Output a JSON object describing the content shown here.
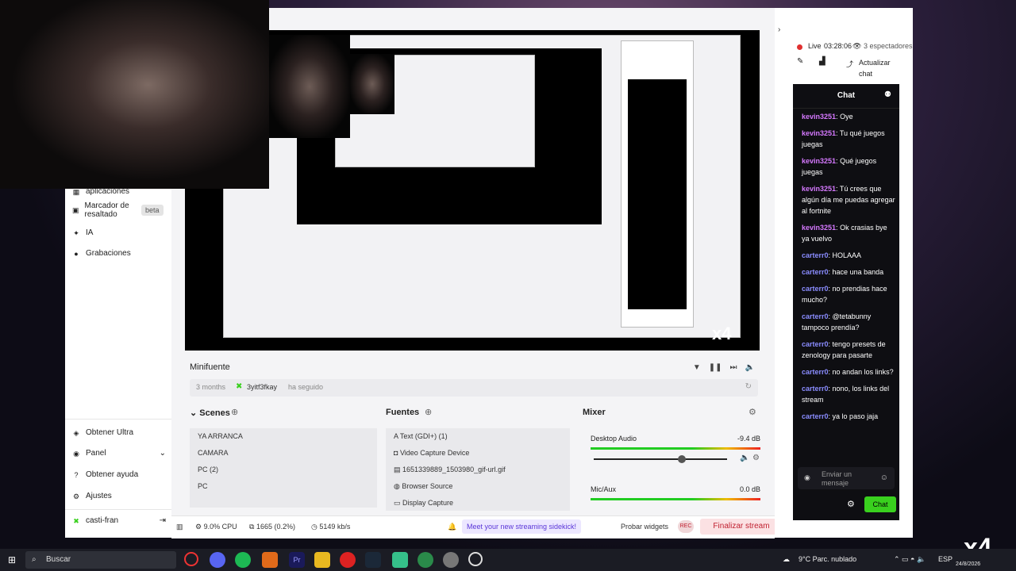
{
  "window": {
    "controls": [
      "—",
      "☐",
      "✕"
    ]
  },
  "sidebar": {
    "top_items": [
      {
        "label": "aplicaciones",
        "icon": "apps-icon"
      },
      {
        "label": "Marcador de resaltado",
        "icon": "highlight-icon",
        "badge": "beta"
      },
      {
        "label": "IA",
        "icon": "ai-sparkle-icon"
      },
      {
        "label": "Grabaciones",
        "icon": "recordings-icon"
      }
    ],
    "bottom_items": [
      {
        "label": "Obtener Ultra",
        "icon": "ultra-icon"
      },
      {
        "label": "Panel",
        "icon": "panel-icon"
      },
      {
        "label": "Obtener ayuda",
        "icon": "help-icon"
      },
      {
        "label": "Ajustes",
        "icon": "settings-icon"
      }
    ],
    "user": {
      "name": "casti-fran"
    }
  },
  "minifuente": {
    "title": "Minifuente",
    "event": {
      "time": "3 months",
      "user": "3yitf3fkay",
      "action": "ha seguido"
    }
  },
  "scenes": {
    "title": "Scenes",
    "items": [
      "YA ARRANCA",
      "CAMARA",
      "PC (2)",
      "PC"
    ]
  },
  "sources": {
    "title": "Fuentes",
    "items": [
      "Text (GDI+) (1)",
      "Video Capture Device",
      "1651339889_1503980_gif-url.gif",
      "Browser Source",
      "Display Capture"
    ]
  },
  "mixer": {
    "title": "Mixer",
    "channels": [
      {
        "name": "Desktop Audio",
        "db": "-9.4 dB",
        "level": 0.63
      },
      {
        "name": "Mic/Aux",
        "db": "0.0 dB",
        "level": 0.0
      }
    ]
  },
  "status": {
    "cpu": "9.0% CPU",
    "frames": "1665 (0.2%)",
    "bitrate": "5149 kb/s",
    "sidekick": "Meet your new streaming sidekick!",
    "probar": "Probar widgets",
    "rec": "REC",
    "finalizar": "Finalizar stream"
  },
  "live": {
    "label": "Live",
    "time": "03:28:06",
    "viewers": "3 espectadores",
    "refresh": "Actualizar chat"
  },
  "chat": {
    "title": "Chat",
    "messages": [
      {
        "user": "kevin3251",
        "text": "Oye",
        "kind": "k"
      },
      {
        "user": "kevin3251",
        "text": "Tu qué juegos juegas",
        "kind": "k"
      },
      {
        "user": "kevin3251",
        "text": "Qué juegos juegas",
        "kind": "k"
      },
      {
        "user": "kevin3251",
        "text": "Tú crees que algún día me puedas agregar al fortnite",
        "kind": "k"
      },
      {
        "user": "kevin3251",
        "text": "Ok crasias bye ya vuelvo",
        "kind": "k"
      },
      {
        "user": "carterr0",
        "text": "HOLAAA",
        "kind": "c"
      },
      {
        "user": "carterr0",
        "text": "hace una banda",
        "kind": "c"
      },
      {
        "user": "carterr0",
        "text": "no prendias hace mucho?",
        "kind": "c"
      },
      {
        "user": "carterr0",
        "text": "@tetabunny tampoco prendía?",
        "kind": "c"
      },
      {
        "user": "carterr0",
        "text": "tengo presets de zenology para pasarte",
        "kind": "c"
      },
      {
        "user": "carterr0",
        "text": "no andan los links?",
        "kind": "c"
      },
      {
        "user": "carterr0",
        "text": "nono, los links del stream",
        "kind": "c"
      },
      {
        "user": "carterr0",
        "text": "ya lo paso jaja",
        "kind": "c"
      }
    ],
    "placeholder": "Enviar un mensaje",
    "button": "Chat"
  },
  "overlay": {
    "x4": "x4"
  },
  "taskbar": {
    "search": "Buscar",
    "weather": "9°C  Parc. nublado",
    "lang": "ESP",
    "date": "24/8/2026"
  },
  "colors": {
    "accent": "#39d01e",
    "danger": "#c02030",
    "chat_bg": "#0e0e12",
    "sidekick": "#5a36d8"
  }
}
